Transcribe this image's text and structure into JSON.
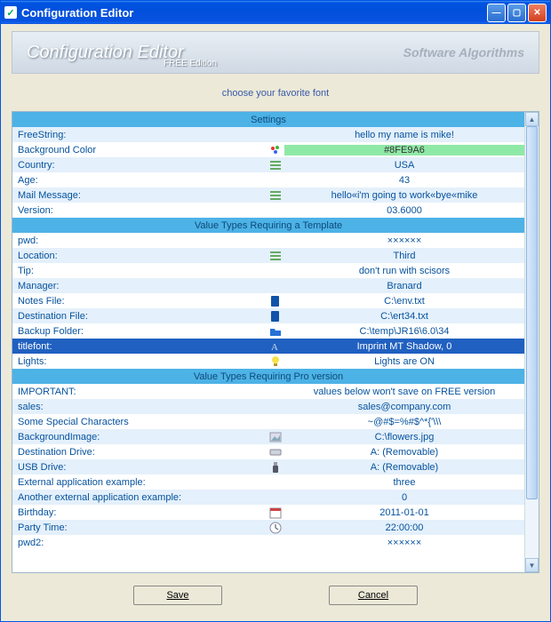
{
  "window": {
    "title": "Configuration Editor"
  },
  "banner": {
    "title": "Configuration Editor",
    "subtitle": "FREE Edition",
    "brand": "Software Algorithms"
  },
  "prompt": "choose your favorite font",
  "sections": {
    "s1": "Settings",
    "s2": "Value Types Requiring a Template",
    "s3": "Value Types Requiring Pro version"
  },
  "rows": {
    "free_label": "FreeString:",
    "free_val": "hello my name is mike!",
    "bg_label": "Background Color",
    "bg_val": "#8FE9A6",
    "country_label": "Country:",
    "country_val": "USA",
    "age_label": "Age:",
    "age_val": "43",
    "mail_label": "Mail Message:",
    "mail_val": "hello«i'm going to work«bye«mike",
    "version_label": "Version:",
    "version_val": "03.6000",
    "pwd_label": "pwd:",
    "pwd_val": "××××××",
    "loc_label": "Location:",
    "loc_val": "Third",
    "tip_label": "Tip:",
    "tip_val": "don't run with scisors",
    "mgr_label": "Manager:",
    "mgr_val": "Branard",
    "notes_label": "Notes File:",
    "notes_val": "C:\\env.txt",
    "dest_label": "Destination File:",
    "dest_val": "C:\\ert34.txt",
    "backup_label": "Backup Folder:",
    "backup_val": "C:\\temp\\JR16\\6.0\\34",
    "titlefont_label": "titlefont:",
    "titlefont_val": "Imprint MT Shadow, 0",
    "lights_label": "Lights:",
    "lights_val": "Lights are ON",
    "important_label": "IMPORTANT:",
    "important_val": "values below won't save on FREE version",
    "sales_label": "sales:",
    "sales_val": "sales@company.com",
    "special_label": "Some Special Characters",
    "special_val": "~@#$=%#$^*{'\\\\\\",
    "bgimg_label": "BackgroundImage:",
    "bgimg_val": "C:\\flowers.jpg",
    "ddrive_label": "Destination Drive:",
    "ddrive_val": "A: (Removable)",
    "usb_label": "USB Drive:",
    "usb_val": "A: (Removable)",
    "ext1_label": "External application example:",
    "ext1_val": "three",
    "ext2_label": "Another external application example:",
    "ext2_val": "0",
    "bday_label": "Birthday:",
    "bday_val": "2011-01-01",
    "ptime_label": "Party Time:",
    "ptime_val": "22:00:00",
    "pwd2_label": "pwd2:",
    "pwd2_val": "××××××"
  },
  "icons": {
    "palette": "palette-icon",
    "list": "list-icon",
    "file": "file-icon",
    "folder": "folder-icon",
    "font": "font-icon",
    "bulb": "bulb-icon",
    "image": "image-icon",
    "drive": "drive-icon",
    "usb": "usb-icon",
    "calendar": "calendar-icon",
    "clock": "clock-icon"
  },
  "buttons": {
    "save": "Save",
    "cancel": "Cancel"
  }
}
